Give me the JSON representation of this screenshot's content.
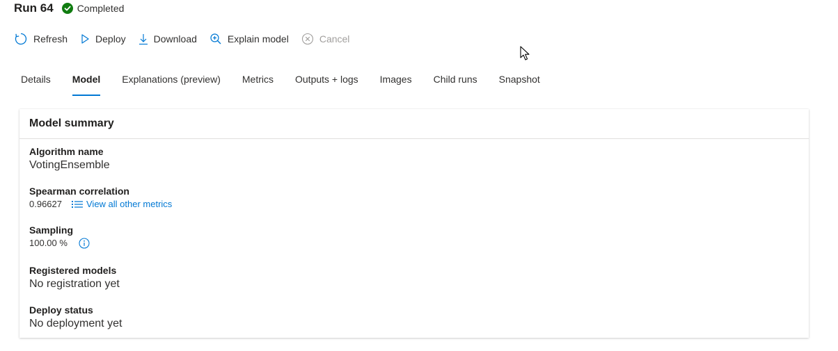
{
  "header": {
    "run_title": "Run 64",
    "status": "Completed",
    "status_color": "#107c10",
    "status_icon": "check-circle-icon"
  },
  "toolbar": {
    "refresh_label": "Refresh",
    "deploy_label": "Deploy",
    "download_label": "Download",
    "explain_label": "Explain model",
    "cancel_label": "Cancel"
  },
  "tabs": [
    {
      "label": "Details",
      "active": false
    },
    {
      "label": "Model",
      "active": true
    },
    {
      "label": "Explanations (preview)",
      "active": false
    },
    {
      "label": "Metrics",
      "active": false
    },
    {
      "label": "Outputs + logs",
      "active": false
    },
    {
      "label": "Images",
      "active": false
    },
    {
      "label": "Child runs",
      "active": false
    },
    {
      "label": "Snapshot",
      "active": false
    }
  ],
  "card": {
    "title": "Model summary",
    "algorithm": {
      "label": "Algorithm name",
      "value": "VotingEnsemble"
    },
    "spearman": {
      "label": "Spearman correlation",
      "value": "0.96627",
      "link": "View all other metrics"
    },
    "sampling": {
      "label": "Sampling",
      "value": "100.00 %"
    },
    "registered": {
      "label": "Registered models",
      "value": "No registration yet"
    },
    "deploy_status": {
      "label": "Deploy status",
      "value": "No deployment yet"
    }
  },
  "colors": {
    "accent": "#0078d4",
    "text": "#323130",
    "disabled": "#a19f9d"
  }
}
